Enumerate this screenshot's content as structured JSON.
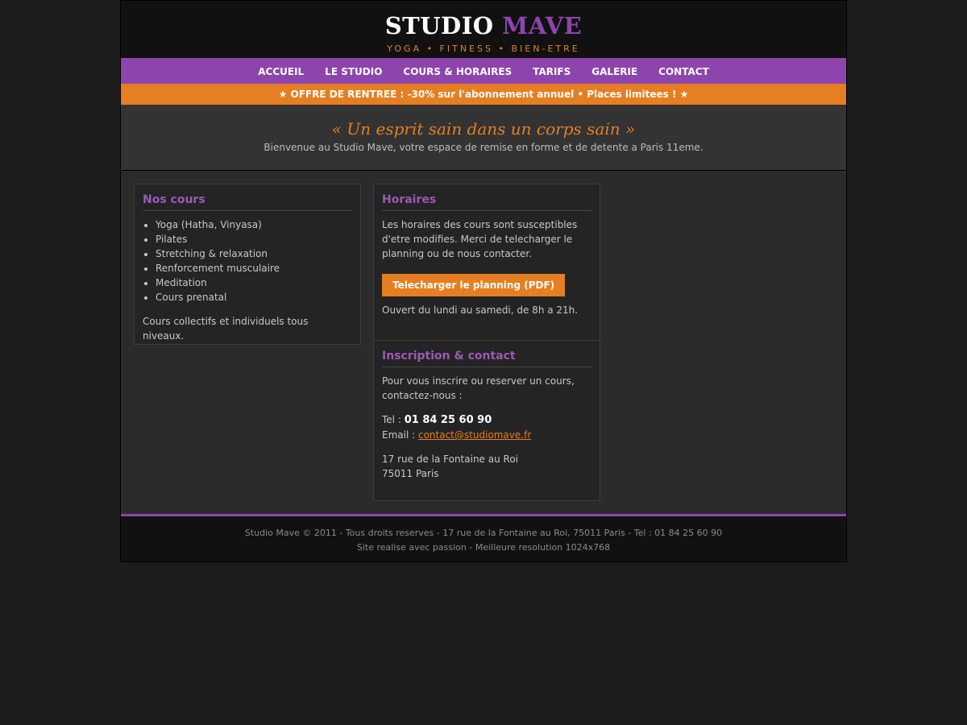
{
  "header": {
    "logo_main": "STUDIO",
    "logo_accent": "MAVE",
    "tagline": "YOGA • FITNESS • BIEN-ETRE"
  },
  "nav": {
    "items": [
      {
        "label": "ACCUEIL"
      },
      {
        "label": "LE STUDIO"
      },
      {
        "label": "COURS & HORAIRES"
      },
      {
        "label": "TARIFS"
      },
      {
        "label": "GALERIE"
      },
      {
        "label": "CONTACT"
      }
    ]
  },
  "promo": {
    "text": "★ OFFRE DE RENTREE : -30% sur l'abonnement annuel • Places limitees ! ★"
  },
  "hero": {
    "slogan": "« Un esprit sain dans un corps sain »",
    "welcome": "Bienvenue au Studio Mave, votre espace de remise en forme et de detente a Paris 11eme."
  },
  "cours": {
    "title": "Nos cours",
    "items": [
      "Yoga (Hatha, Vinyasa)",
      "Pilates",
      "Stretching & relaxation",
      "Renforcement musculaire",
      "Meditation",
      "Cours prenatal"
    ],
    "note": "Cours collectifs et individuels tous niveaux."
  },
  "horaires": {
    "title": "Horaires",
    "text": "Les horaires des cours sont susceptibles d'etre modifies. Merci de telecharger le planning ou de nous contacter.",
    "button": "Telecharger le planning (PDF)",
    "opening": "Ouvert du lundi au samedi, de 8h a 21h."
  },
  "contact": {
    "title": "Inscription & contact",
    "intro": "Pour vous inscrire ou reserver un cours, contactez-nous :",
    "tel_label": "Tel :",
    "tel": "01 84 25 60 90",
    "email_label": "Email :",
    "email": "contact@studiomave.fr",
    "address1": "17 rue de la Fontaine au Roi",
    "address2": "75011 Paris"
  },
  "footer": {
    "line1": "Studio Mave © 2011 - Tous droits reserves - 17 rue de la Fontaine au Roi, 75011 Paris - Tel : 01 84 25 60 90",
    "line2": "Site realise avec passion - Meilleure resolution 1024x768"
  },
  "colors": {
    "accent_purple": "#8e44ad",
    "accent_orange": "#e67e22",
    "background": "#1c1c1c"
  }
}
